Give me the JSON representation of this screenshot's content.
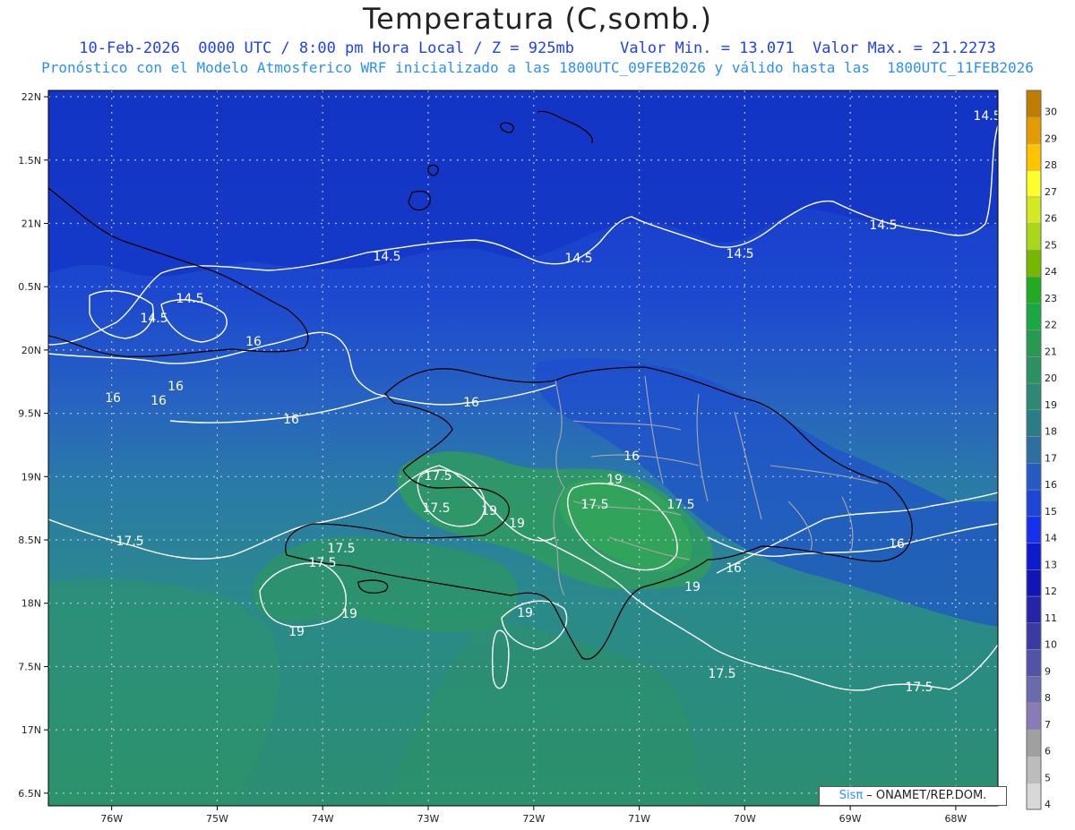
{
  "title": "Temperatura (C,somb.)",
  "subtitle_line1": "10-Feb-2026  0000 UTC / 8:00 pm Hora Local / Z = 925mb     Valor Min. = 13.071  Valor Max. = 21.2273",
  "subtitle_line2": "Pronóstico con el Modelo Atmosferico WRF inicializado a las 1800UTC_09FEB2026 y válido hasta las  1800UTC_11FEB2026",
  "credit": {
    "sis": "Sisπ",
    "rest": " – ONAMET/REP.DOM."
  },
  "chart_data": {
    "type": "heatmap",
    "title": "Temperatura (C,somb.)",
    "units": "C",
    "value_min": 13.071,
    "value_max": 21.2273,
    "x_ticks": [
      "76W",
      "75W",
      "74W",
      "73W",
      "72W",
      "71W",
      "70W",
      "69W",
      "68W"
    ],
    "y_ticks": [
      "22N",
      "1.5N",
      "21N",
      "0.5N",
      "20N",
      "9.5N",
      "19N",
      "8.5N",
      "18N",
      "7.5N",
      "17N",
      "6.5N"
    ],
    "x_range": [
      -76.6,
      -67.6
    ],
    "y_range": [
      16.4,
      22.05
    ],
    "grid": true,
    "colorbar_levels": [
      "30",
      "29",
      "28",
      "27",
      "26",
      "25",
      "24",
      "23",
      "22",
      "21",
      "20",
      "19",
      "18",
      "17",
      "16",
      "15",
      "14",
      "13",
      "12",
      "11",
      "10",
      "9",
      "8",
      "7",
      "6",
      "5",
      "4"
    ],
    "colorbar_colors": [
      "#c07c00",
      "#e39b00",
      "#ffc300",
      "#ffff2a",
      "#d4ea20",
      "#a8d818",
      "#76b800",
      "#22aa22",
      "#1aa845",
      "#279a52",
      "#2b9163",
      "#2d8874",
      "#2a7c86",
      "#2d6fa2",
      "#265ac2",
      "#1f44d8",
      "#1530ee",
      "#0d1ad0",
      "#1215b5",
      "#2424a8",
      "#3a3aa5",
      "#5252a8",
      "#6a6aad",
      "#8a7ab5",
      "#a0a0a0",
      "#bcbcbc",
      "#d8d8d8"
    ],
    "contours": [
      {
        "level": "14.5",
        "labels": [
          "14.5",
          "14.5",
          "14.5",
          "14.5",
          "14.5",
          "14.5",
          "14.5"
        ]
      },
      {
        "level": "16",
        "labels": [
          "16",
          "16",
          "16",
          "16",
          "16",
          "16",
          "16",
          "16"
        ]
      },
      {
        "level": "17.5",
        "labels": [
          "17.5",
          "17.5",
          "17.5",
          "17.5",
          "17.5",
          "17.5",
          "17.5",
          "17.5"
        ]
      },
      {
        "level": "19",
        "labels": [
          "19",
          "19",
          "19",
          "19",
          "19",
          "19",
          "19"
        ]
      }
    ]
  }
}
